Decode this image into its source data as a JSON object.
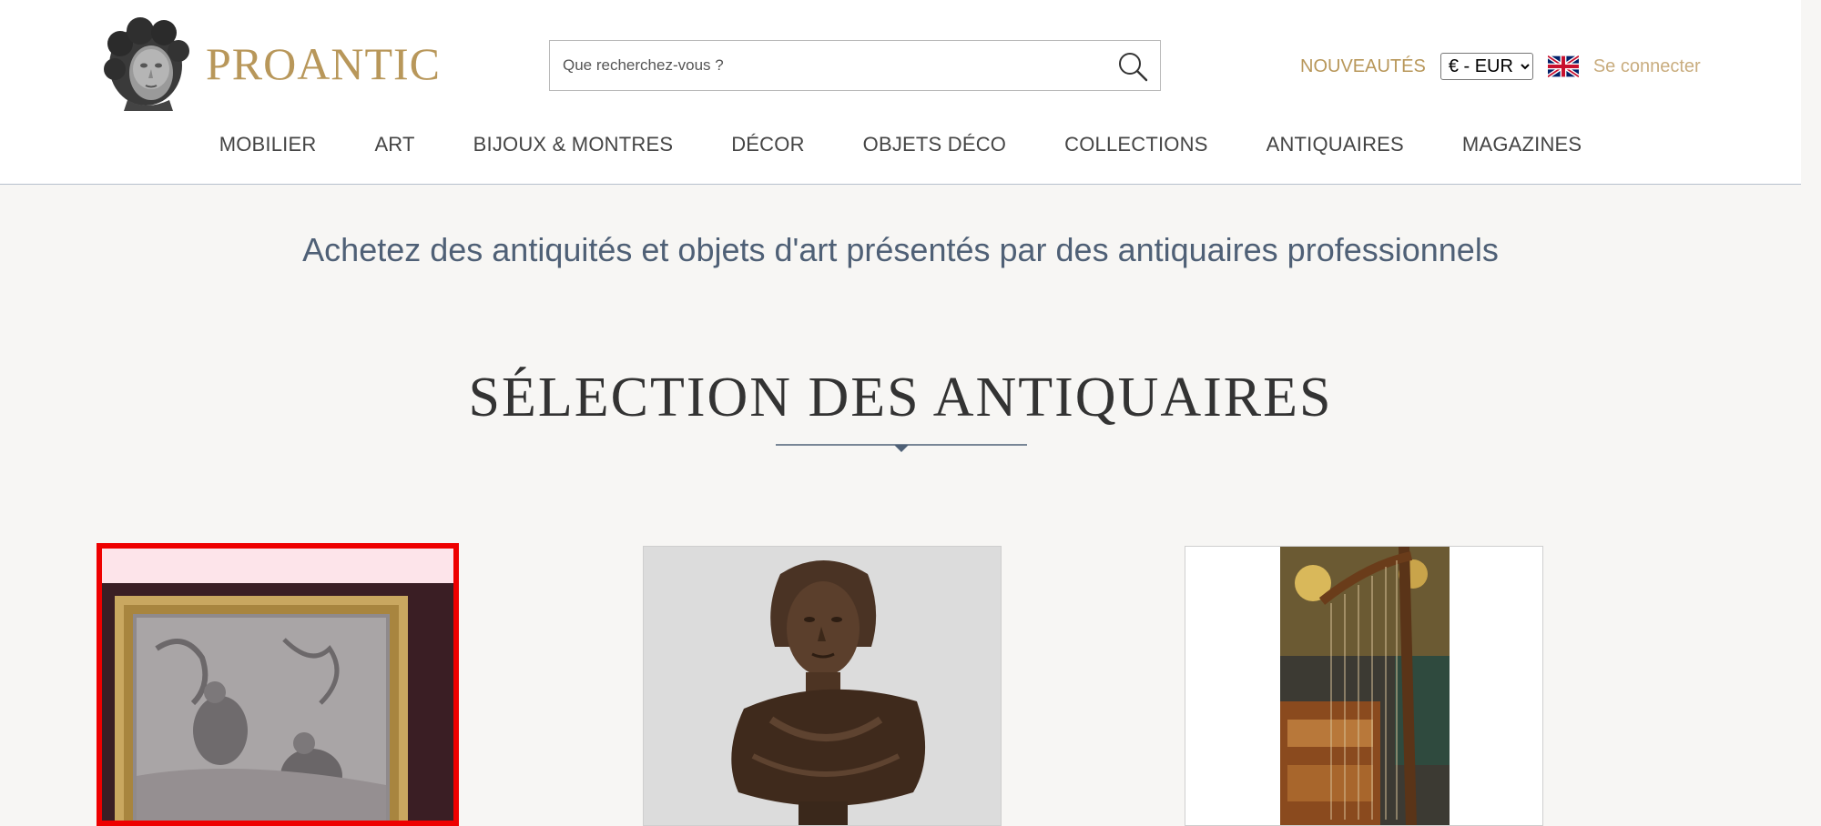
{
  "header": {
    "logo_text": "PROANTIC",
    "search": {
      "placeholder": "Que recherchez-vous ?"
    },
    "nouveautes": "NOUVEAUTÉS",
    "currency": {
      "selected": "€ - EUR"
    },
    "language_icon": "uk-flag-icon",
    "login": "Se connecter"
  },
  "nav": {
    "items": [
      "MOBILIER",
      "ART",
      "BIJOUX & MONTRES",
      "DÉCOR",
      "OBJETS DÉCO",
      "COLLECTIONS",
      "ANTIQUAIRES",
      "MAGAZINES"
    ]
  },
  "hero": {
    "tagline": "Achetez des antiquités et objets d'art présentés par des antiquaires professionnels"
  },
  "selection": {
    "title": "SÉLECTION DES ANTIQUAIRES"
  },
  "colors": {
    "brand_gold": "#b8975a",
    "slate_blue": "#4f6076",
    "highlight_red": "#ee0000"
  }
}
